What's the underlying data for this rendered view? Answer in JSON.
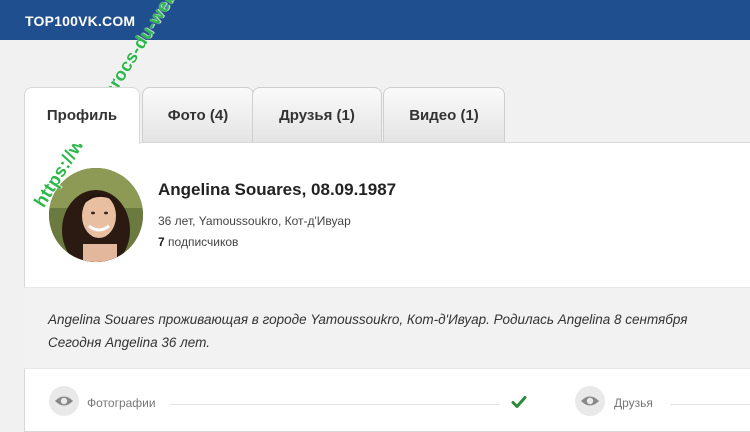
{
  "header": {
    "brand": "TOP100VK.COM"
  },
  "tabs": [
    {
      "label": "Профиль",
      "active": true
    },
    {
      "label": "Фото (4)"
    },
    {
      "label": "Друзья (1)"
    },
    {
      "label": "Видео (1)"
    }
  ],
  "profile": {
    "name": "Angelina Souares, 08.09.1987",
    "meta": "36 лет, Yamoussoukro, Кот-д'Ивуар",
    "subscribers_count": "7",
    "subscribers_label": "подписчиков"
  },
  "bio": {
    "text": "Angelina Souares проживающая в городе Yamoussoukro, Кот-д'Ивуар. Родилась Angelina 8 сентября\nСегодня Angelina 36 лет."
  },
  "stats": {
    "photos_label": "Фотографии",
    "friends_label": "Друзья"
  },
  "watermark": "https://www.escrocs-du-web.fr",
  "colors": {
    "header_bg": "#1f4f8e",
    "check": "#2a8a3a",
    "watermark": "#2db84a"
  }
}
